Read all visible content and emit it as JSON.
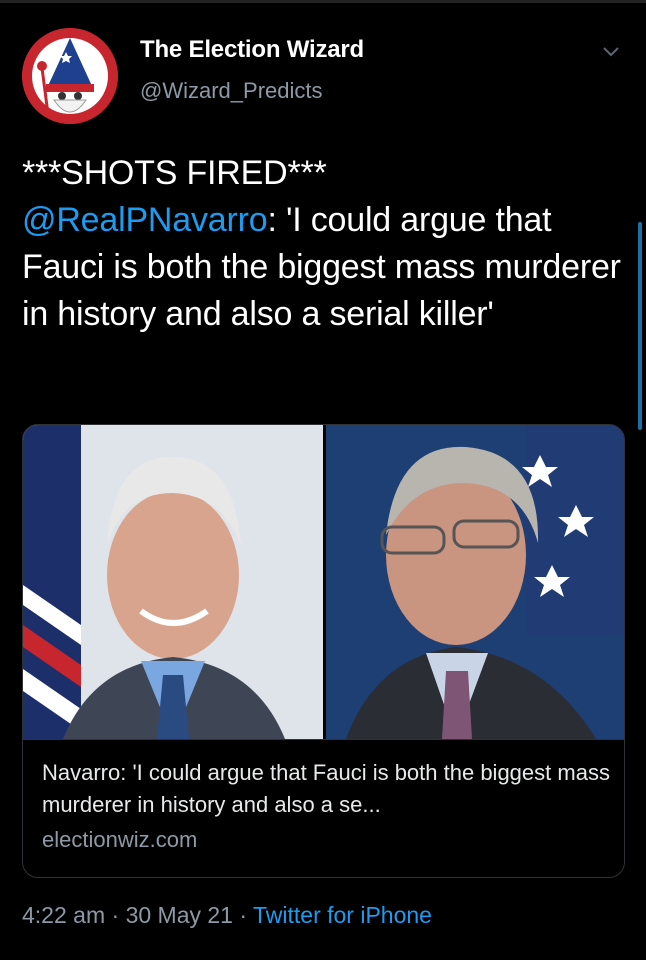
{
  "account": {
    "display_name": "The Election Wizard",
    "handle": "@Wizard_Predicts"
  },
  "tweet": {
    "line1": "***SHOTS FIRED***",
    "mention": "@RealPNavarro",
    "text_after_mention": ": 'I could argue that Fauci is both the biggest mass murderer in history and also a serial killer'"
  },
  "link_card": {
    "title": "Navarro: 'I could argue that Fauci is both the biggest mass murderer in history and also a se...",
    "domain": "electionwiz.com"
  },
  "meta": {
    "time": "4:22 am",
    "separator1": " · ",
    "date": "30 May 21",
    "separator2": " · ",
    "source": "Twitter for iPhone"
  },
  "colors": {
    "background": "#000000",
    "link_blue": "#1d9bf0",
    "secondary_text": "#8d99a6",
    "avatar_red": "#c8262f"
  },
  "icons": {
    "avatar": "wizard-avatar",
    "menu": "chevron-down-icon"
  }
}
